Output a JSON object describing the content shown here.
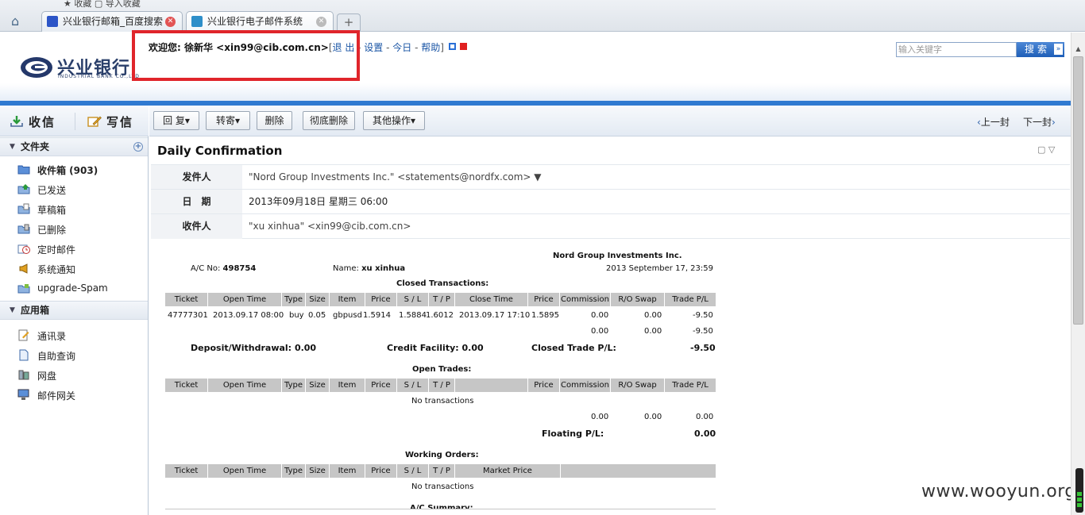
{
  "browser": {
    "bookmarks": "★ 收藏  ▢ 导入收藏",
    "tabs": [
      {
        "label": "兴业银行邮箱_百度搜索"
      },
      {
        "label": "兴业银行电子邮件系统"
      }
    ],
    "new_tab": "+"
  },
  "header": {
    "logo_text": "兴业银行",
    "logo_sub": "INDUSTRIAL BANK CO.,LTD",
    "welcome_prefix": "欢迎您: 徐新华 <xin99@cib.com.cn>",
    "bracket_open": "[",
    "logout": "退 出",
    "settings": "设置",
    "today": "今日",
    "help": "帮助",
    "bracket_close": "]",
    "dash": " - ",
    "search_placeholder": "输入关键字",
    "search_button": "搜索",
    "search_arrow": "»"
  },
  "left_toolbar": {
    "receive": "收信",
    "compose": "写信"
  },
  "mail_toolbar": {
    "reply": "回 复▾",
    "forward": "转寄▾",
    "delete": "删除",
    "delete_permanent": "彻底删除",
    "other": "其他操作▾",
    "prev": "上一封",
    "next": "下一封"
  },
  "sidebar": {
    "folders_title": "文件夹",
    "folders": [
      {
        "label": "收件箱 (903)"
      },
      {
        "label": "已发送"
      },
      {
        "label": "草稿箱"
      },
      {
        "label": "已删除"
      },
      {
        "label": "定时邮件"
      },
      {
        "label": "系统通知"
      },
      {
        "label": "upgrade-Spam"
      }
    ],
    "apps_title": "应用箱",
    "apps": [
      {
        "label": "通讯录"
      },
      {
        "label": "自助查询"
      },
      {
        "label": "网盘"
      },
      {
        "label": "邮件网关"
      }
    ]
  },
  "message": {
    "subject": "Daily Confirmation",
    "from_label": "发件人",
    "from_value": "\"Nord Group Investments Inc.\" <statements@nordfx.com> ▼",
    "date_label": "日　期",
    "date_value": "2013年09月18日 星期三 06:00",
    "to_label": "收件人",
    "to_value": "\"xu xinhua\" <xin99@cib.com.cn>"
  },
  "statement": {
    "company": "Nord Group Investments Inc.",
    "account_label": "A/C No:",
    "account_no": "498754",
    "name_label": "Name:",
    "name": "xu xinhua",
    "datetime": "2013 September 17, 23:59",
    "closed_title": "Closed Transactions:",
    "closed_headers": [
      "Ticket",
      "Open Time",
      "Type",
      "Size",
      "Item",
      "Price",
      "S / L",
      "T / P",
      "Close Time",
      "Price",
      "Commission",
      "R/O Swap",
      "Trade P/L"
    ],
    "closed_row": [
      "47777301",
      "2013.09.17 08:00",
      "buy",
      "0.05",
      "gbpusd",
      "1.5914",
      "1.5884",
      "1.6012",
      "2013.09.17 17:10",
      "1.5895",
      "0.00",
      "0.00",
      "-9.50"
    ],
    "closed_totals": [
      "0.00",
      "0.00",
      "-9.50"
    ],
    "deposit_label": "Deposit/Withdrawal:",
    "deposit_value": "0.00",
    "credit_label": "Credit Facility:",
    "credit_value": "0.00",
    "closed_pl_label": "Closed Trade P/L:",
    "closed_pl_value": "-9.50",
    "open_title": "Open Trades:",
    "open_headers": [
      "Ticket",
      "Open Time",
      "Type",
      "Size",
      "Item",
      "Price",
      "S / L",
      "T / P",
      "",
      "Price",
      "Commission",
      "R/O Swap",
      "Trade P/L"
    ],
    "no_transactions": "No transactions",
    "open_totals": [
      "0.00",
      "0.00",
      "0.00"
    ],
    "floating_label": "Floating P/L:",
    "floating_value": "0.00",
    "working_title": "Working Orders:",
    "working_headers": [
      "Ticket",
      "Open Time",
      "Type",
      "Size",
      "Item",
      "Price",
      "S / L",
      "T / P",
      "Market Price",
      ""
    ],
    "summary_title": "A/C Summary:"
  },
  "watermark": "www.wooyun.org",
  "colors": {
    "accent": "#2f7ad1",
    "highlight": "#e0252b",
    "table_header": "#c6c6c6"
  }
}
